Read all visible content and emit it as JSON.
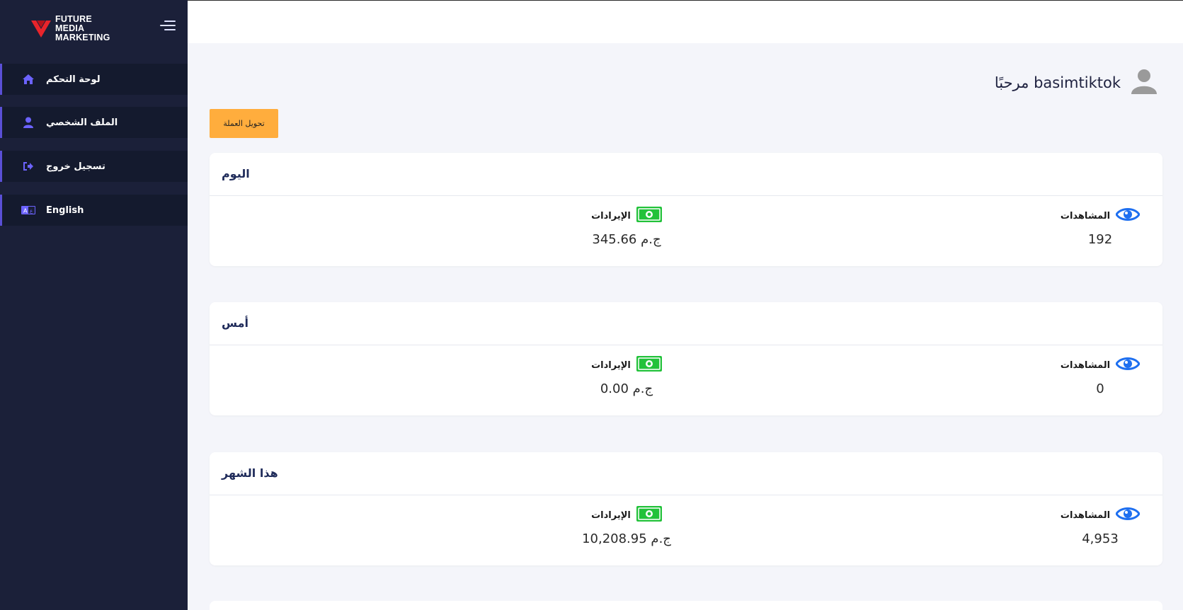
{
  "brand": {
    "logo_lines": [
      "FUTURE",
      "MEDIA",
      "MARKETING"
    ],
    "accent_color": "#e8242b"
  },
  "sidebar": {
    "items": [
      {
        "label": "لوحة التحكم",
        "icon": "home-icon"
      },
      {
        "label": "الملف الشخصي",
        "icon": "user-icon"
      },
      {
        "label": "تسجيل خروج",
        "icon": "logout-icon"
      },
      {
        "label": "English",
        "icon": "language-icon"
      }
    ]
  },
  "header": {
    "greeting": "مرحبًا basimtiktok"
  },
  "actions": {
    "convert_currency": "تحويل العملة"
  },
  "cards": [
    {
      "title": "اليوم",
      "views_label": "المشاهدات",
      "views": "192",
      "revenue_label": "الإيرادات",
      "revenue": "345.66 ج.م"
    },
    {
      "title": "أمس",
      "views_label": "المشاهدات",
      "views": "0",
      "revenue_label": "الإيرادات",
      "revenue": "0.00 ج.م"
    },
    {
      "title": "هذا الشهر",
      "views_label": "المشاهدات",
      "views": "4,953",
      "revenue_label": "الإيرادات",
      "revenue": "10,208.95 ج.م"
    }
  ],
  "colors": {
    "sidebar_bg": "#1b2039",
    "nav_active": "#141a2e",
    "nav_icon": "#6c63ff",
    "button_bg": "#ffad3d",
    "money_icon": "#22c23a",
    "eye_icon": "#1e6ff0"
  }
}
